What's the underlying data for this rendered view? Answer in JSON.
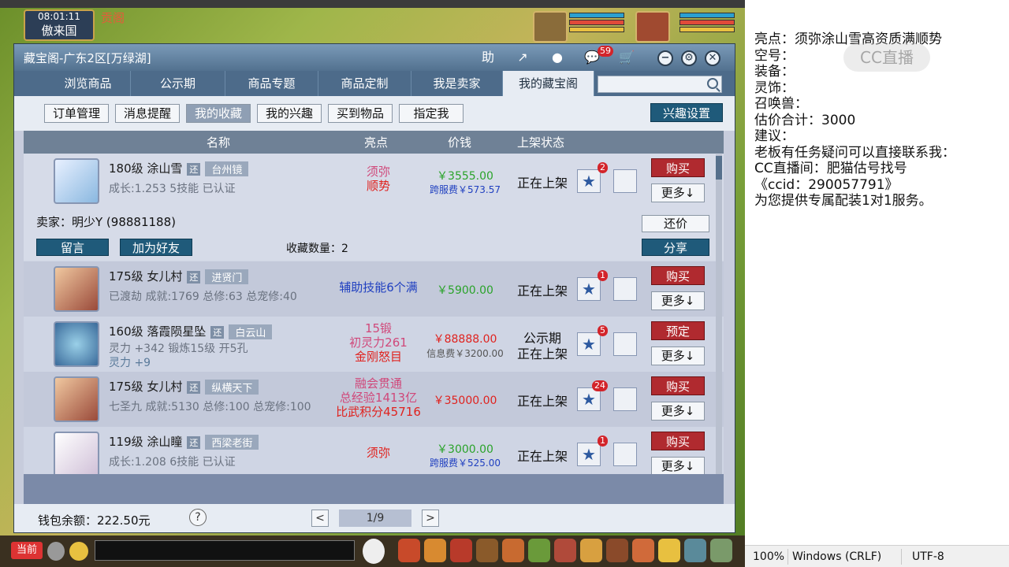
{
  "game": {
    "clock_time": "08:01:11",
    "server_name": "傲来国",
    "banner_text": "贡阁"
  },
  "window": {
    "title": "藏宝阁-广东2区[万绿湖]",
    "assist_label": "助",
    "msg_count": "59"
  },
  "tabs": [
    {
      "label": "浏览商品"
    },
    {
      "label": "公示期"
    },
    {
      "label": "商品专题"
    },
    {
      "label": "商品定制"
    },
    {
      "label": "我是卖家"
    },
    {
      "label": "我的藏宝阁"
    }
  ],
  "search": {
    "placeholder": ""
  },
  "subnav": [
    {
      "label": "订单管理"
    },
    {
      "label": "消息提醒"
    },
    {
      "label": "我的收藏"
    },
    {
      "label": "我的兴趣"
    },
    {
      "label": "买到物品"
    },
    {
      "label": "指定我"
    }
  ],
  "interest_settings": "兴趣设置",
  "columns": {
    "name": "名称",
    "highlight": "亮点",
    "price": "价钱",
    "status": "上架状态"
  },
  "items": [
    {
      "level_name": "180级  涂山雪",
      "huan": "还",
      "location": "台州镜",
      "detail": "成长:1.253  5技能  已认证",
      "highlight1": "须弥",
      "highlight2": "顺势",
      "highlight3": "",
      "price": "￥3555.00",
      "fee": "跨服费￥573.57",
      "status": "正在上架",
      "status2": "",
      "fav_count": "2",
      "action": "购买",
      "more": "更多↓"
    },
    {
      "level_name": "175级  女儿村",
      "huan": "还",
      "location": "进贤门",
      "detail": "已渡劫  成就:1769  总修:63  总宠修:40",
      "highlight1": "辅助技能6个满",
      "highlight2": "",
      "highlight3": "",
      "price": "￥5900.00",
      "fee": "",
      "status": "正在上架",
      "status2": "",
      "fav_count": "1",
      "action": "购买",
      "more": "更多↓"
    },
    {
      "level_name": "160级  落霞陨星坠",
      "huan": "还",
      "location": "白云山",
      "detail": "灵力 +342  锻炼15级  开5孔",
      "detail2": "灵力 +9",
      "highlight1": "15锻",
      "highlight2": "初灵力261",
      "highlight3": "金刚怒目",
      "price": "￥88888.00",
      "fee": "信息费￥3200.00",
      "status": "公示期",
      "status2": "正在上架",
      "fav_count": "5",
      "action": "预定",
      "more": "更多↓"
    },
    {
      "level_name": "175级  女儿村",
      "huan": "还",
      "location": "纵横天下",
      "detail": "七圣九  成就:5130  总修:100  总宠修:100",
      "highlight1": "融会贯通",
      "highlight2": "总经验1413亿",
      "highlight3": "比武积分45716",
      "price": "￥35000.00",
      "fee": "",
      "status": "正在上架",
      "status2": "",
      "fav_count": "24",
      "action": "购买",
      "more": "更多↓"
    },
    {
      "level_name": "119级  涂山瞳",
      "huan": "还",
      "location": "西梁老街",
      "detail": "成长:1.208  6技能  已认证",
      "highlight1": "须弥",
      "highlight2": "",
      "highlight3": "",
      "price": "￥3000.00",
      "fee": "跨服费￥525.00",
      "status": "正在上架",
      "status2": "",
      "fav_count": "1",
      "action": "购买",
      "more": "更多↓"
    }
  ],
  "seller": {
    "label": "卖家：明少Y (98881188)",
    "message_btn": "留言",
    "friend_btn": "加为好友",
    "fav_count_label": "收藏数量：2",
    "counter_btn": "还价",
    "share_btn": "分享"
  },
  "footer": {
    "wallet": "钱包余额：222.50元",
    "help": "?",
    "page": "1/9",
    "prev": "<",
    "next": ">"
  },
  "bottom_strip": {
    "current_label": "当前"
  },
  "notepad": {
    "lines": [
      "亮点：须弥涂山雪高资质满顺势",
      "空号：",
      "装备：",
      "灵饰：",
      "召唤兽：",
      "估价合计：3000",
      "建议：",
      "老板有任务疑问可以直接联系我：",
      "CC直播间：肥猫估号找号",
      "《ccid：290057791》",
      "为您提供专属配装1对1服务。"
    ],
    "watermark": "CC直播",
    "status_zoom": "100%",
    "status_eol": "Windows (CRLF)",
    "status_enc": "UTF-8"
  },
  "colors": {
    "accent": "#1f5a7a",
    "buy": "#b02a2f",
    "tabbar": "#4d6b8a"
  },
  "icons": [
    "assist-icon",
    "share-icon",
    "stop-icon",
    "chat-icon",
    "cart-icon",
    "minimize-icon",
    "settings-icon",
    "close-icon",
    "star-icon",
    "search-icon"
  ]
}
